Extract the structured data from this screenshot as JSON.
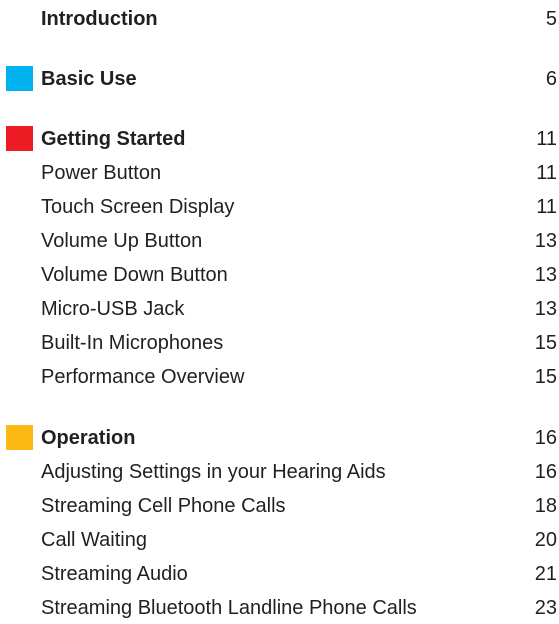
{
  "sections": [
    {
      "title": "Introduction",
      "page": "5",
      "color": null,
      "items": []
    },
    {
      "title": "Basic Use",
      "page": "6",
      "color": "#00b3f0",
      "items": []
    },
    {
      "title": "Getting Started",
      "page": "11",
      "color": "#ed1c24",
      "items": [
        {
          "title": "Power Button",
          "page": "11"
        },
        {
          "title": "Touch Screen Display",
          "page": "11"
        },
        {
          "title": "Volume Up Button",
          "page": "13"
        },
        {
          "title": "Volume Down Button",
          "page": "13"
        },
        {
          "title": "Micro-USB Jack",
          "page": "13"
        },
        {
          "title": "Built-In Microphones",
          "page": "15"
        },
        {
          "title": "Performance Overview",
          "page": "15"
        }
      ]
    },
    {
      "title": "Operation",
      "page": "16",
      "color": "#fdb913",
      "items": [
        {
          "title": "Adjusting Settings in your Hearing Aids",
          "page": "16"
        },
        {
          "title": "Streaming Cell Phone Calls",
          "page": "18"
        },
        {
          "title": "Call Waiting",
          "page": "20"
        },
        {
          "title": "Streaming Audio",
          "page": "21"
        },
        {
          "title": "Streaming Bluetooth Landline Phone Calls",
          "page": "23"
        }
      ]
    }
  ]
}
